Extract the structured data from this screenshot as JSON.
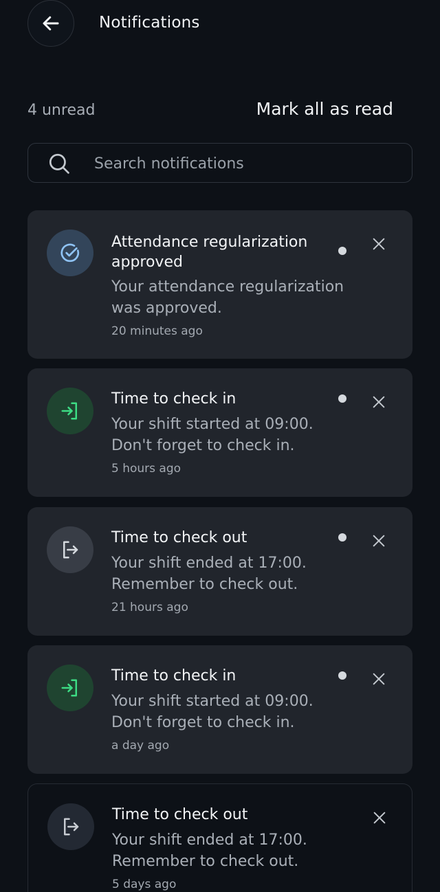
{
  "header": {
    "title": "Notifications",
    "back_icon": "arrow-left-icon"
  },
  "summary": {
    "unread_label": "4 unread",
    "mark_all_label": "Mark all as read"
  },
  "search": {
    "placeholder": "Search notifications",
    "value": ""
  },
  "notifications": [
    {
      "title_line1": "Attendance regularization",
      "title_line2": "approved",
      "message_line1": "Your attendance regularization",
      "message_line2": "was approved.",
      "time": "20 minutes ago",
      "icon": "check-circle-icon",
      "icon_color": "#8fc3f5",
      "unread": true
    },
    {
      "title_line1": "Time to check in",
      "message_line1": "Your shift started at 09:00.",
      "message_line2": "Don't forget to check in.",
      "time": "5 hours ago",
      "icon": "check-in-icon",
      "icon_color": "#3ddc84",
      "unread": true
    },
    {
      "title_line1": "Time to check out",
      "message_line1": "Your shift ended at 17:00.",
      "message_line2": "Remember to check out.",
      "time": "21 hours ago",
      "icon": "check-out-icon",
      "icon_color": "#d5d9de",
      "unread": true
    },
    {
      "title_line1": "Time to check in",
      "message_line1": "Your shift started at 09:00.",
      "message_line2": "Don't forget to check in.",
      "time": "a day ago",
      "icon": "check-in-icon",
      "icon_color": "#3ddc84",
      "unread": true
    },
    {
      "title_line1": "Time to check out",
      "message_line1": "Your shift ended at 17:00.",
      "message_line2": "Remember to check out.",
      "time": "5 days ago",
      "icon": "check-out-icon",
      "icon_color": "#c8ccd2",
      "unread": false
    }
  ],
  "colors": {
    "background": "#0d1117",
    "card": "#21252c",
    "unread_dot": "#d5d9de"
  }
}
